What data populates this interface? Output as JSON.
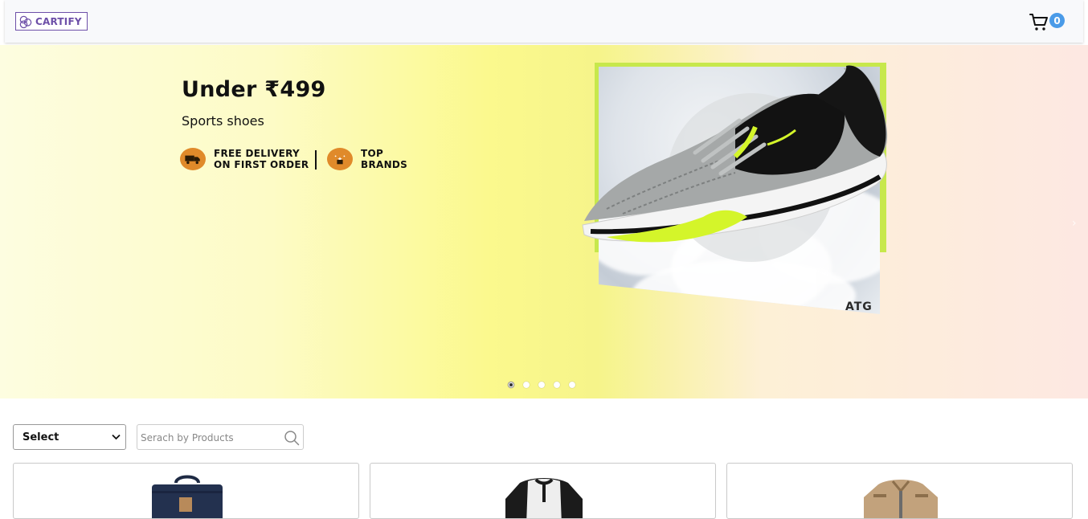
{
  "navbar": {
    "logo_text": "CARTIFY",
    "cart_count": "0",
    "icons": [
      "logo-icon",
      "cart-icon"
    ]
  },
  "banner": {
    "title": "Under ₹499",
    "subtitle": "Sports shoes",
    "features": [
      {
        "line1": "FREE DELIVERY",
        "line2": "ON FIRST ORDER",
        "icon": "truck-icon"
      },
      {
        "line1": "TOP",
        "line2": "BRANDS",
        "icon": "star-badge-icon"
      }
    ],
    "brand": "ATG",
    "slides": 5,
    "active_slide": 1,
    "colors": {
      "accent": "#c7e84c",
      "badge": "#e08a2a"
    }
  },
  "filters": {
    "category_selected": "Select",
    "search_placeholder": "Serach by Products"
  },
  "products": [
    {
      "image": "backpack"
    },
    {
      "image": "henley-shirt"
    },
    {
      "image": "jacket"
    }
  ]
}
